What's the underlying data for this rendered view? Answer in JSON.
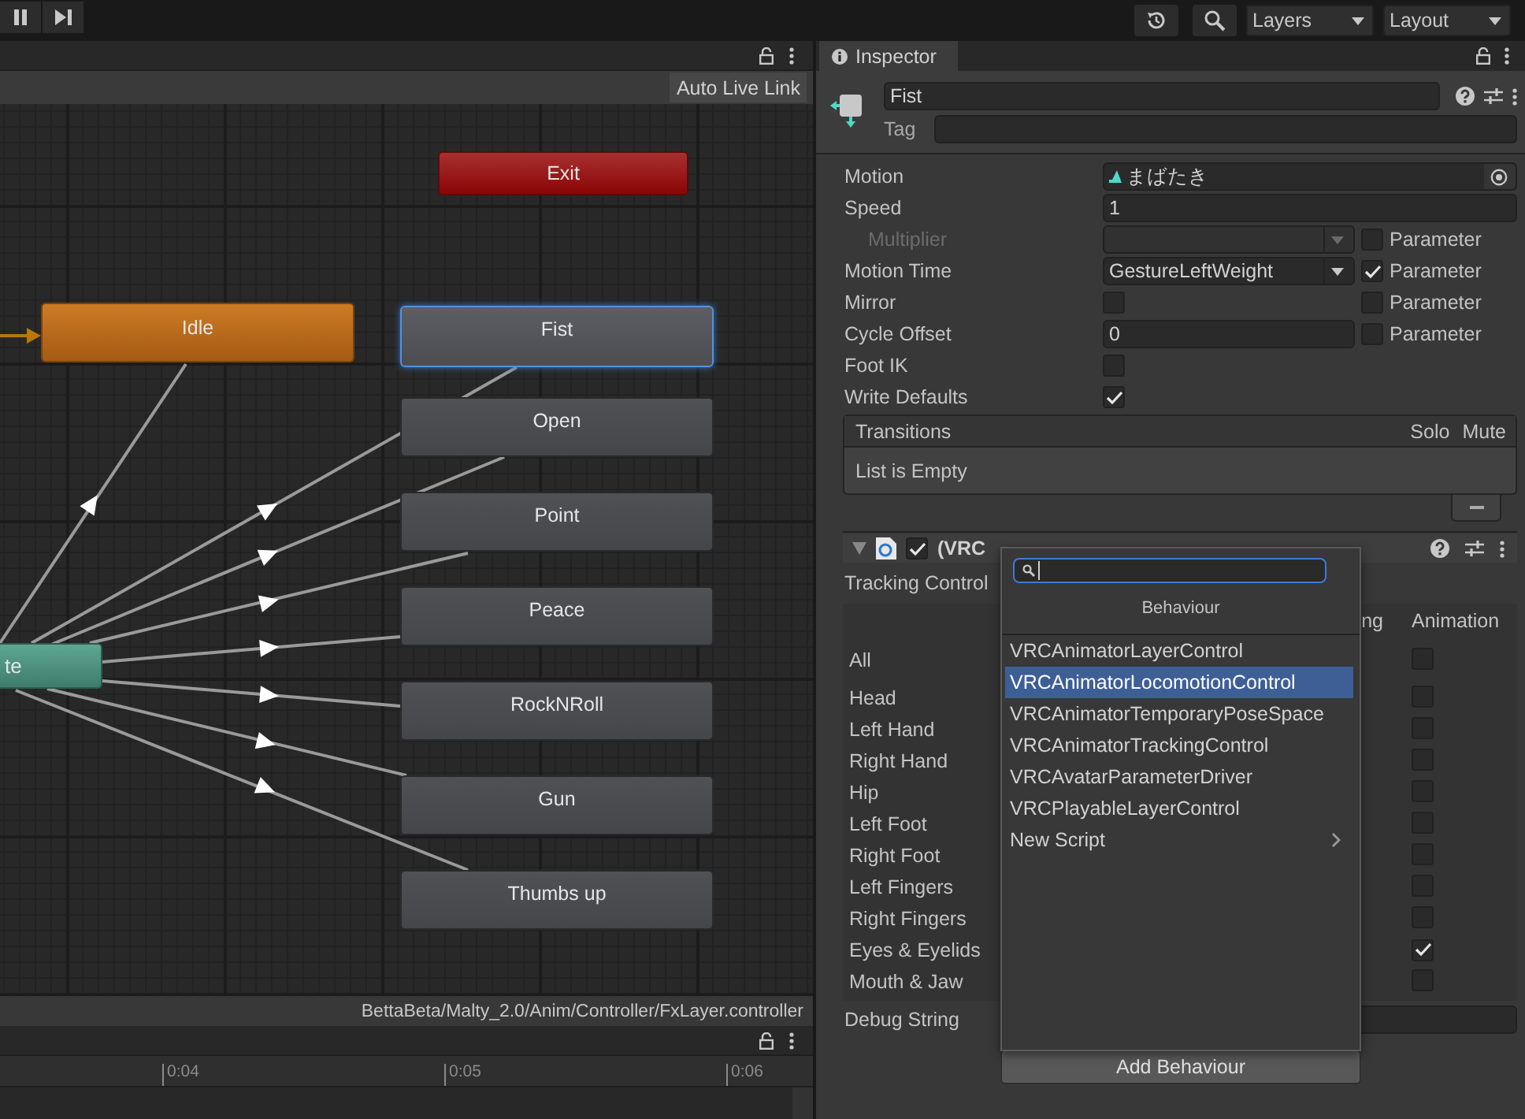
{
  "toolbar": {
    "layers": "Layers",
    "layout": "Layout"
  },
  "animator": {
    "toolbar_button": "Auto Live Link",
    "nodes": [
      {
        "label": "Exit",
        "kind": "exit",
        "selected": false
      },
      {
        "label": "Idle",
        "kind": "default",
        "selected": false
      },
      {
        "label": "Fist",
        "kind": "state",
        "selected": true
      },
      {
        "label": "Open",
        "kind": "state",
        "selected": false
      },
      {
        "label": "Point",
        "kind": "state",
        "selected": false
      },
      {
        "label": "Peace",
        "kind": "state",
        "selected": false
      },
      {
        "label": "RockNRoll",
        "kind": "state",
        "selected": false
      },
      {
        "label": "Gun",
        "kind": "state",
        "selected": false
      },
      {
        "label": "Thumbs up",
        "kind": "state",
        "selected": false
      },
      {
        "label": "te",
        "kind": "any",
        "selected": false
      }
    ],
    "path": "BettaBeta/Malty_2.0/Anim/Controller/FxLayer.controller"
  },
  "timeline": {
    "ticks": [
      "0:04",
      "0:05",
      "0:06"
    ]
  },
  "inspector": {
    "tab": "Inspector",
    "name": "Fist",
    "tag_label": "Tag",
    "properties": [
      {
        "label": "Motion",
        "kind": "object",
        "value": "まばたき",
        "disabled": false
      },
      {
        "label": "Speed",
        "kind": "text",
        "value": "1",
        "disabled": false
      },
      {
        "label": "Multiplier",
        "kind": "dropdown",
        "disabled": true,
        "parameter": {
          "label": "Parameter",
          "checked": false
        }
      },
      {
        "label": "Motion Time",
        "kind": "dropdown",
        "value": "GestureLeftWeight",
        "disabled": false,
        "parameter": {
          "label": "Parameter",
          "checked": true
        }
      },
      {
        "label": "Mirror",
        "kind": "checkbox",
        "checked": false,
        "disabled": false,
        "parameter": {
          "label": "Parameter",
          "checked": false
        }
      },
      {
        "label": "Cycle Offset",
        "kind": "text",
        "value": "0",
        "disabled": false,
        "parameter": {
          "label": "Parameter",
          "checked": false
        }
      },
      {
        "label": "Foot IK",
        "kind": "checkbox",
        "checked": false,
        "disabled": false
      },
      {
        "label": "Write Defaults",
        "kind": "checkbox",
        "checked": true,
        "disabled": false
      }
    ],
    "transitions": {
      "title": "Transitions",
      "columns": [
        "Solo",
        "Mute"
      ],
      "empty": "List is Empty"
    },
    "behaviour": {
      "title": "(VRC",
      "expanded": true,
      "enabled": true,
      "tracking_label": "Tracking Control",
      "columns": [
        "ng",
        "Animation"
      ],
      "rows": [
        {
          "label": "All",
          "animation": false
        },
        {
          "label": "Head",
          "animation": false
        },
        {
          "label": "Left Hand",
          "animation": false
        },
        {
          "label": "Right Hand",
          "animation": false
        },
        {
          "label": "Hip",
          "animation": false
        },
        {
          "label": "Left Foot",
          "animation": false
        },
        {
          "label": "Right Foot",
          "animation": false
        },
        {
          "label": "Left Fingers",
          "animation": false
        },
        {
          "label": "Right Fingers",
          "animation": false
        },
        {
          "label": "Eyes & Eyelids",
          "animation": true
        },
        {
          "label": "Mouth & Jaw",
          "animation": false
        }
      ],
      "debug_label": "Debug String"
    },
    "add_button": "Add Behaviour",
    "popup": {
      "header": "Behaviour",
      "items": [
        {
          "label": "VRCAnimatorLayerControl",
          "selected": false,
          "submenu": false
        },
        {
          "label": "VRCAnimatorLocomotionControl",
          "selected": true,
          "submenu": false
        },
        {
          "label": "VRCAnimatorTemporaryPoseSpace",
          "selected": false,
          "submenu": false
        },
        {
          "label": "VRCAnimatorTrackingControl",
          "selected": false,
          "submenu": false
        },
        {
          "label": "VRCAvatarParameterDriver",
          "selected": false,
          "submenu": false
        },
        {
          "label": "VRCPlayableLayerControl",
          "selected": false,
          "submenu": false
        },
        {
          "label": "New Script",
          "selected": false,
          "submenu": true
        }
      ]
    }
  }
}
